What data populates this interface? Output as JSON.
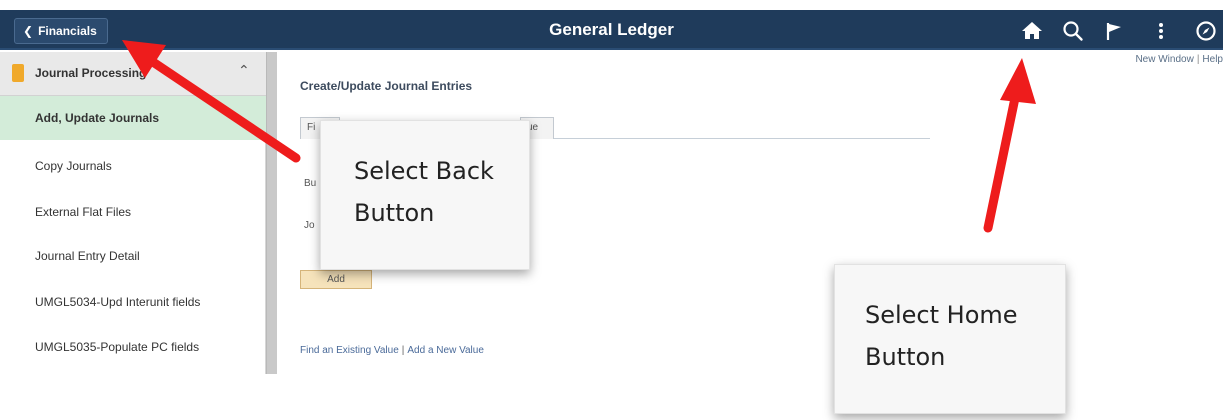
{
  "header": {
    "back_label": "Financials",
    "title": "General Ledger",
    "icons": [
      "home-icon",
      "search-icon",
      "flag-icon",
      "more-vertical-icon",
      "compass-icon"
    ]
  },
  "top_links": {
    "new_window": "New Window",
    "separator": "|",
    "help": "Help"
  },
  "sidebar": {
    "section": "Journal Processing",
    "items": [
      {
        "label": "Add, Update Journals",
        "active": true
      },
      {
        "label": "Copy Journals"
      },
      {
        "label": "External Flat Files"
      },
      {
        "label": "Journal Entry Detail"
      },
      {
        "label": "UMGL5034-Upd Interunit fields"
      },
      {
        "label": "UMGL5035-Populate PC fields"
      }
    ]
  },
  "main": {
    "page_title": "Create/Update Journal Entries",
    "tab_fragment_1": "Fi",
    "tab_fragment_2": "ue",
    "field_fragment_1": "Bu",
    "field_fragment_2": "Jo",
    "add_button": "Add",
    "link_find": "Find an Existing Value",
    "link_separator": "|",
    "link_add": "Add a New Value"
  },
  "callouts": {
    "back": [
      "Select Back",
      "Button"
    ],
    "home": [
      "Select Home",
      "Button"
    ]
  },
  "colors": {
    "header_bg": "#1f3b5b",
    "active_item_bg": "#d3ecd9",
    "arrow": "#ee1c1c"
  }
}
